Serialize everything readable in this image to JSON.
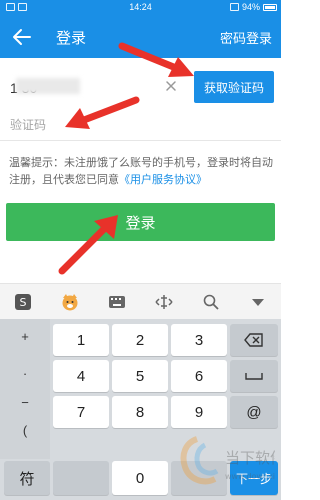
{
  "status_bar": {
    "time": "14:24",
    "battery": "94%"
  },
  "app_bar": {
    "title": "登录",
    "right_link": "密码登录"
  },
  "phone_field": {
    "value": "1 30"
  },
  "get_code_button": {
    "label": "获取验证码"
  },
  "code_field": {
    "placeholder": "验证码"
  },
  "notice": {
    "text": "温馨提示：未注册饿了么账号的手机号，登录时将自动注册，且代表您已同意",
    "link": "《用户服务协议》"
  },
  "login_button": {
    "label": "登录"
  },
  "keyboard": {
    "symbols": [
      "+",
      ".",
      "−",
      "("
    ],
    "digits": [
      "1",
      "2",
      "3",
      "4",
      "5",
      "6",
      "7",
      "8",
      "9",
      "0"
    ],
    "right_keys": [
      "@"
    ],
    "bottom_left": "符",
    "enter_label": "下一步"
  },
  "watermark": {
    "text": "当下软件园",
    "url": "www.downxia.com"
  },
  "colors": {
    "blue": "#1a8fe6",
    "green": "#3cb85b",
    "arrow": "#e8322a"
  }
}
